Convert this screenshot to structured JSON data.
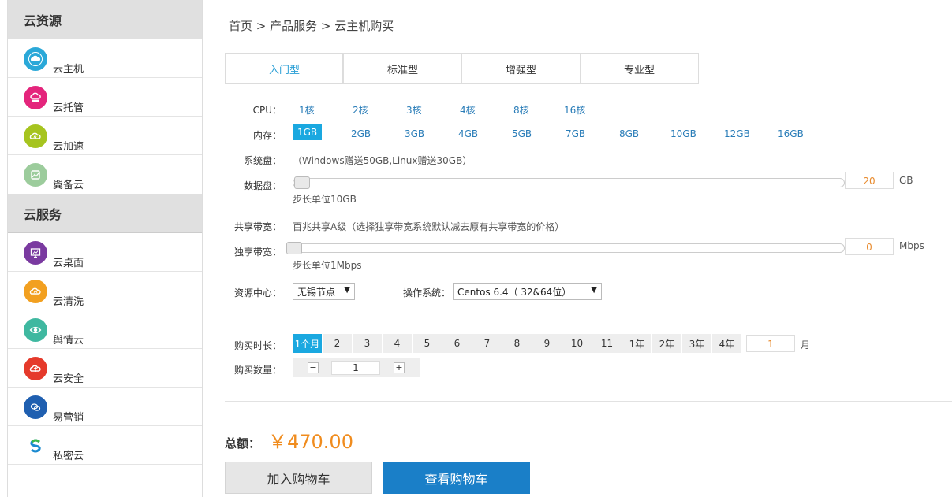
{
  "sidebar": {
    "sections": [
      {
        "title": "云资源",
        "items": [
          {
            "label": "云主机",
            "icon": "cloud-icon",
            "color": "#2aa8d8"
          },
          {
            "label": "云托管",
            "icon": "cloud-upload-icon",
            "color": "#e4257c"
          },
          {
            "label": "云加速",
            "icon": "cloud-lightning-icon",
            "color": "#a6c41f"
          },
          {
            "label": "翼备云",
            "icon": "backup-icon",
            "color": "#9ccc9c"
          }
        ]
      },
      {
        "title": "云服务",
        "items": [
          {
            "label": "云桌面",
            "icon": "desktop-icon",
            "color": "#7a3aa0"
          },
          {
            "label": "云清洗",
            "icon": "cloud-clean-icon",
            "color": "#f2a020"
          },
          {
            "label": "舆情云",
            "icon": "eye-icon",
            "color": "#3fb8a0"
          },
          {
            "label": "云安全",
            "icon": "shield-upload-icon",
            "color": "#e53a2b"
          },
          {
            "label": "易营销",
            "icon": "chat-icon",
            "color": "#1f5fb0"
          },
          {
            "label": "私密云",
            "icon": "s-logo-icon",
            "color": "#1a8ad0"
          }
        ]
      }
    ]
  },
  "breadcrumb": "首页 > 产品服务 > 云主机购买",
  "tabs": [
    "入门型",
    "标准型",
    "增强型",
    "专业型"
  ],
  "active_tab": "入门型",
  "config": {
    "cpu_label": "CPU：",
    "cpu_options": [
      "1核",
      "2核",
      "3核",
      "4核",
      "8核",
      "16核"
    ],
    "memory_label": "内存：",
    "memory_options": [
      "1GB",
      "2GB",
      "3GB",
      "4GB",
      "5GB",
      "7GB",
      "8GB",
      "10GB",
      "12GB",
      "16GB"
    ],
    "memory_selected": "1GB",
    "system_disk_label": "系统盘：",
    "system_disk_note": "（Windows赠送50GB,Linux赠送30GB）",
    "data_disk_label": "数据盘：",
    "data_disk_value": "20",
    "data_disk_unit": "GB",
    "data_disk_step": "步长单位10GB",
    "shared_bw_label": "共享带宽：",
    "shared_bw_note": "百兆共享A级（选择独享带宽系统默认减去原有共享带宽的价格）",
    "dedicated_bw_label": "独享带宽：",
    "dedicated_bw_value": "0",
    "dedicated_bw_unit": "Mbps",
    "dedicated_bw_step": "步长单位1Mbps",
    "resource_center_label": "资源中心：",
    "resource_center_value": "无锡节点",
    "os_label": "操作系统：",
    "os_value": "Centos 6.4（ 32&64位）"
  },
  "purchase": {
    "duration_label": "购买时长：",
    "duration_options": [
      "1个月",
      "2",
      "3",
      "4",
      "5",
      "6",
      "7",
      "8",
      "9",
      "10",
      "11",
      "1年",
      "2年",
      "3年",
      "4年"
    ],
    "duration_selected": "1个月",
    "duration_value": "1",
    "duration_unit": "月",
    "quantity_label": "购买数量：",
    "quantity_value": "1",
    "minus": "−",
    "plus": "+"
  },
  "total": {
    "label": "总额：",
    "value": "￥470.00"
  },
  "buttons": {
    "add_to_cart": "加入购物车",
    "view_cart": "查看购物车"
  },
  "colors": {
    "accent": "#1aa8e0",
    "price": "#f08c1e",
    "primary_button": "#1a7fc8"
  }
}
